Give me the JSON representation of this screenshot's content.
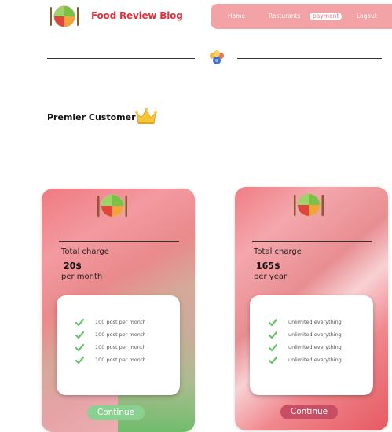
{
  "header": {
    "brand": "Food Review Blog",
    "nav": [
      "Home",
      "Resturants",
      "payment",
      "Logout"
    ],
    "active_nav": "payment"
  },
  "section_title": "Premier Customer",
  "plans": [
    {
      "charge_label": "Total charge",
      "price": "20$",
      "period": "per month",
      "features": [
        "100 post per month",
        "100 post per month",
        "100 post per month",
        "100 post per month"
      ],
      "button": "Continue"
    },
    {
      "charge_label": "Total charge",
      "price": "165$",
      "period": "per year",
      "features": [
        "unlimited everything",
        "unlimited everything",
        "unlimited everything",
        "unlimited everything"
      ],
      "button": "Continue"
    }
  ],
  "colors": {
    "brand": "#e0323c",
    "nav_bg": "#f3a2a5",
    "check": "#6cc36e",
    "continue_monthly": "#8ad191",
    "continue_yearly": "#c84e63"
  },
  "icons": [
    "food-plate-icon",
    "payment-badge-icon",
    "crown-icon",
    "check-icon"
  ]
}
